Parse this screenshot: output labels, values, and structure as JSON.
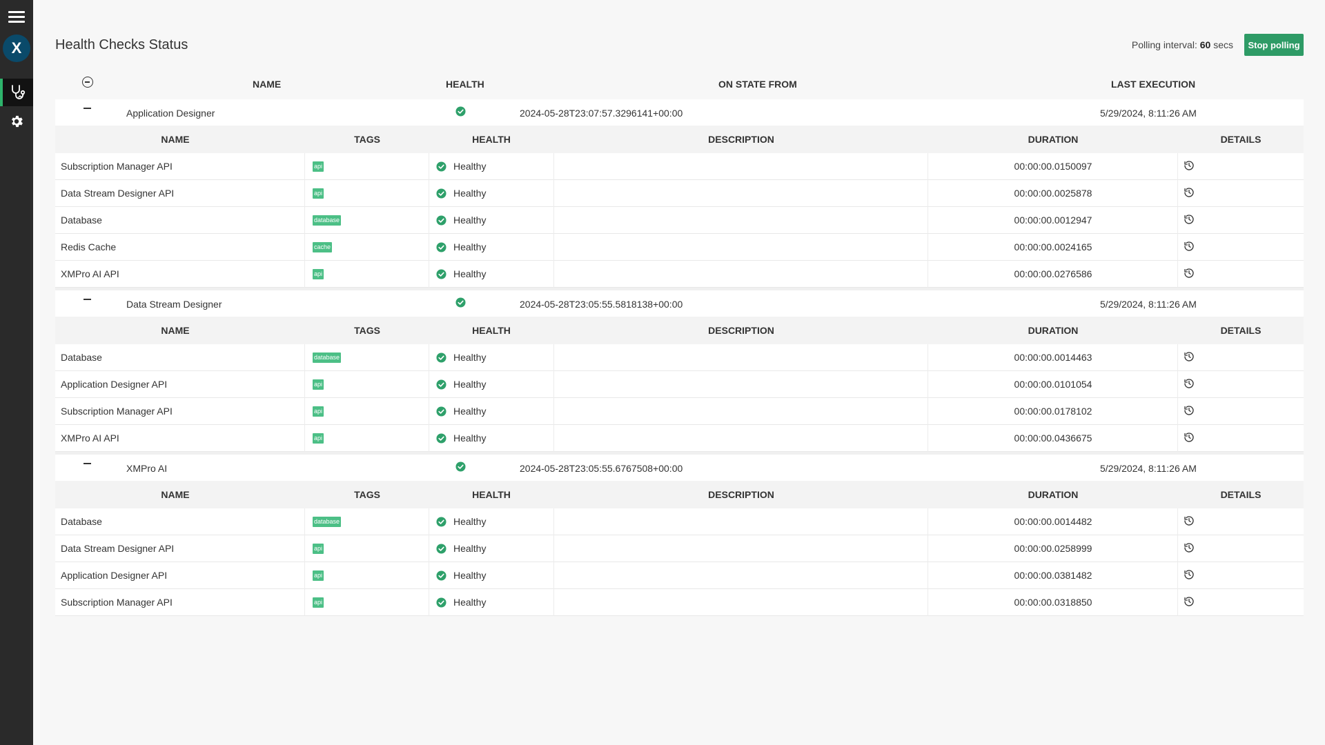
{
  "header": {
    "title": "Health Checks Status",
    "polling_label": "Polling interval:",
    "polling_value": "60",
    "polling_unit": "secs",
    "stop_button": "Stop polling"
  },
  "colors": {
    "accent": "#2e9b66",
    "tag": "#4cbf86",
    "sidebar": "#2a2a2a",
    "logo": "#0a4a6a"
  },
  "icons": {
    "menu": "hamburger-icon",
    "logo": "x-logo",
    "health": "stethoscope-icon",
    "settings": "gear-icon",
    "status": "check-circle-icon",
    "details": "history-icon"
  },
  "main_columns": {
    "name": "NAME",
    "health": "HEALTH",
    "state_from": "ON STATE FROM",
    "last_execution": "LAST EXECUTION"
  },
  "sub_columns": {
    "name": "NAME",
    "tags": "TAGS",
    "health": "HEALTH",
    "description": "DESCRIPTION",
    "duration": "DURATION",
    "details": "DETAILS"
  },
  "groups": [
    {
      "name": "Application Designer",
      "on_state_from": "2024-05-28T23:07:57.3296141+00:00",
      "last_execution": "5/29/2024, 8:11:26 AM",
      "rows": [
        {
          "name": "Subscription Manager API",
          "tag": "api",
          "health": "Healthy",
          "duration": "00:00:00.0150097"
        },
        {
          "name": "Data Stream Designer API",
          "tag": "api",
          "health": "Healthy",
          "duration": "00:00:00.0025878"
        },
        {
          "name": "Database",
          "tag": "database",
          "health": "Healthy",
          "duration": "00:00:00.0012947"
        },
        {
          "name": "Redis Cache",
          "tag": "cache",
          "health": "Healthy",
          "duration": "00:00:00.0024165"
        },
        {
          "name": "XMPro AI API",
          "tag": "api",
          "health": "Healthy",
          "duration": "00:00:00.0276586"
        }
      ]
    },
    {
      "name": "Data Stream Designer",
      "on_state_from": "2024-05-28T23:05:55.5818138+00:00",
      "last_execution": "5/29/2024, 8:11:26 AM",
      "rows": [
        {
          "name": "Database",
          "tag": "database",
          "health": "Healthy",
          "duration": "00:00:00.0014463"
        },
        {
          "name": "Application Designer API",
          "tag": "api",
          "health": "Healthy",
          "duration": "00:00:00.0101054"
        },
        {
          "name": "Subscription Manager API",
          "tag": "api",
          "health": "Healthy",
          "duration": "00:00:00.0178102"
        },
        {
          "name": "XMPro AI API",
          "tag": "api",
          "health": "Healthy",
          "duration": "00:00:00.0436675"
        }
      ]
    },
    {
      "name": "XMPro AI",
      "on_state_from": "2024-05-28T23:05:55.6767508+00:00",
      "last_execution": "5/29/2024, 8:11:26 AM",
      "rows": [
        {
          "name": "Database",
          "tag": "database",
          "health": "Healthy",
          "duration": "00:00:00.0014482"
        },
        {
          "name": "Data Stream Designer API",
          "tag": "api",
          "health": "Healthy",
          "duration": "00:00:00.0258999"
        },
        {
          "name": "Application Designer API",
          "tag": "api",
          "health": "Healthy",
          "duration": "00:00:00.0381482"
        },
        {
          "name": "Subscription Manager API",
          "tag": "api",
          "health": "Healthy",
          "duration": "00:00:00.0318850"
        }
      ]
    }
  ]
}
